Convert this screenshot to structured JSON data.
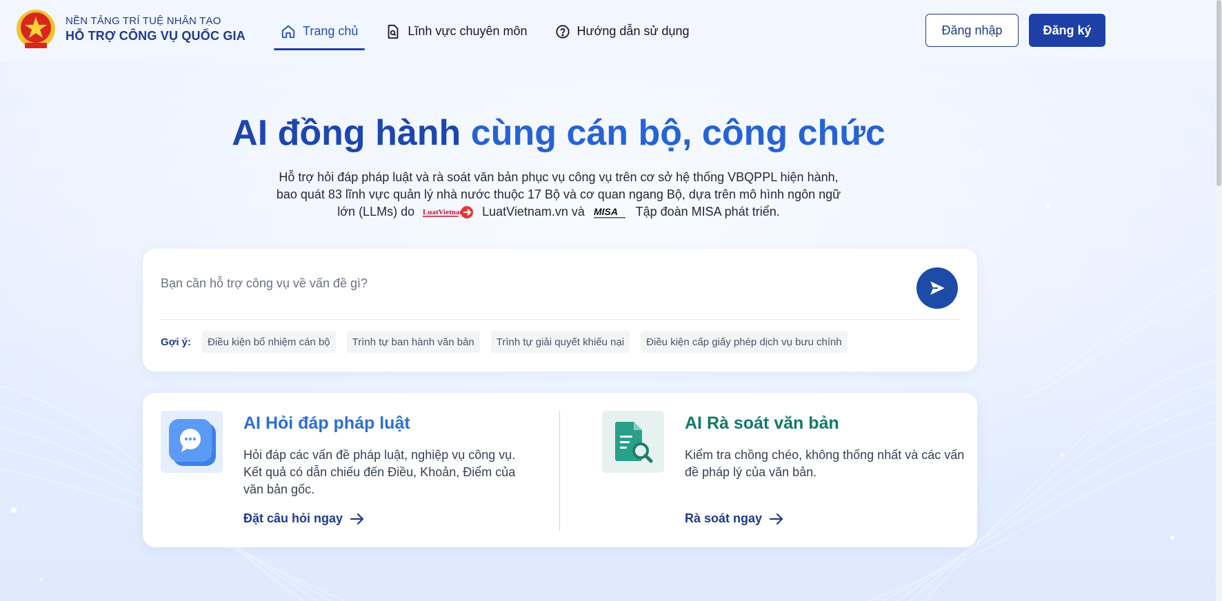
{
  "header": {
    "logo_line1": "NỀN TẢNG TRÍ TUỆ NHÂN TẠO",
    "logo_line2": "HỖ TRỢ CÔNG VỤ QUỐC GIA",
    "nav": [
      {
        "label": "Trang chủ",
        "icon": "home-icon",
        "active": true
      },
      {
        "label": "Lĩnh vực chuyên môn",
        "icon": "document-search-icon",
        "active": false
      },
      {
        "label": "Hướng dẫn sử dụng",
        "icon": "help-circle-icon",
        "active": false
      }
    ],
    "login_label": "Đăng nhập",
    "signup_label": "Đăng ký"
  },
  "hero": {
    "title_part1": "AI đồng hành",
    "title_part2": "cùng cán bộ, công chức",
    "desc_line1": "Hỗ trợ hỏi đáp pháp luật và rà soát văn bản phục vụ công vụ trên cơ sở hệ thống VBQPPL hiện hành,",
    "desc_line2": "bao quát 83 lĩnh vực quản lý nhà nước thuộc 17 Bộ và cơ quan ngang Bộ, dựa trên mô hình ngôn ngữ",
    "desc_line3_a": "lớn (LLMs) do",
    "desc_line3_b": "LuatVietnam.vn và",
    "desc_line3_c": "Tập đoàn MISA phát triển.",
    "logo_luatvietnam": "LuatVietnam",
    "logo_misa": "MISA"
  },
  "search": {
    "placeholder": "Bạn cần hỗ trợ công vụ về vấn đề gì?",
    "suggest_label": "Gợi ý:",
    "suggestions": [
      "Điều kiện bổ nhiệm cán bộ",
      "Trình tự ban hành văn bản",
      "Trình tự giải quyết khiếu nại",
      "Điều kiện cấp giấy phép dịch vụ bưu chính"
    ]
  },
  "features": [
    {
      "title": "AI Hỏi đáp pháp luật",
      "desc": "Hỏi đáp các vấn đề pháp luật, nghiệp vụ công vụ. Kết quả có dẫn chiếu đến Điều, Khoản, Điểm của văn bản gốc.",
      "link": "Đặt câu hỏi ngay",
      "icon": "chat-bubble-icon",
      "color": "#2c6fd6"
    },
    {
      "title": "AI Rà soát văn bản",
      "desc": "Kiểm tra chồng chéo, không thống nhất và các vấn đề pháp lý của văn bản.",
      "link": "Rà soát ngay",
      "icon": "document-magnify-icon",
      "color": "#127a66"
    }
  ],
  "colors": {
    "primary": "#1d3fa6",
    "accent_blue": "#2c6fd6",
    "accent_green": "#127a66"
  }
}
